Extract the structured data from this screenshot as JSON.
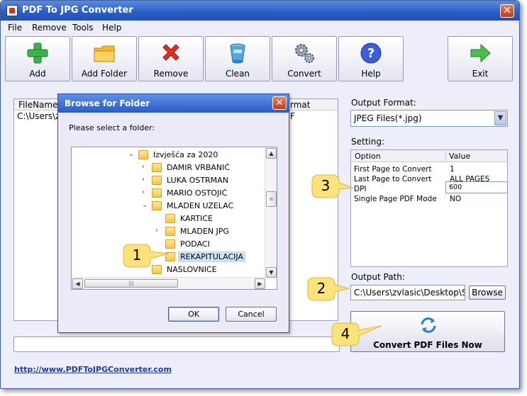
{
  "window": {
    "title": "PDF To JPG Converter",
    "close_glyph": "✕"
  },
  "menu": [
    "File",
    "Remove",
    "Tools",
    "Help"
  ],
  "toolbar": [
    {
      "label": "Add",
      "icon": "add-icon"
    },
    {
      "label": "Add Folder",
      "icon": "folder-icon"
    },
    {
      "label": "Remove",
      "icon": "remove-icon"
    },
    {
      "label": "Clean",
      "icon": "clean-icon"
    },
    {
      "label": "Convert",
      "icon": "convert-gears-icon"
    },
    {
      "label": "Help",
      "icon": "help-icon"
    },
    {
      "label": "Exit",
      "icon": "exit-arrow-icon"
    }
  ],
  "file_list": {
    "columns": [
      "FileName",
      "rmat"
    ],
    "rows": [
      {
        "filename": "C:\\Users\\zv",
        "format": "F"
      }
    ]
  },
  "output_format": {
    "label": "Output Format:",
    "value": "JPEG Files(*.jpg)"
  },
  "setting": {
    "label": "Setting:",
    "columns": [
      "Option",
      "Value"
    ],
    "rows": [
      {
        "option": "First Page to Convert",
        "value": "1"
      },
      {
        "option": "Last Page to Convert",
        "value": "ALL PAGES"
      },
      {
        "option": "DPI",
        "value": "600"
      },
      {
        "option": "Single Page PDF Mode",
        "value": "NO"
      }
    ]
  },
  "output_path": {
    "label": "Output Path:",
    "value": "C:\\Users\\zvlasic\\Desktop\\SAM",
    "browse_label": "Browse"
  },
  "convert_now_label": "Convert PDF Files Now",
  "footer_link": "http://www.PDFToJPGConverter.com",
  "dialog": {
    "title": "Browse for Folder",
    "close_glyph": "✕",
    "prompt": "Please select a folder:",
    "tree": [
      {
        "name": "Izvješća za 2020",
        "expander": "expanded",
        "level": 0
      },
      {
        "name": "DAMIR VRBANIĆ",
        "expander": "collapsed",
        "level": 1
      },
      {
        "name": "LUKA OSTRMAN",
        "expander": "collapsed",
        "level": 1
      },
      {
        "name": "MARIO OSTOJIĆ",
        "expander": "collapsed",
        "level": 1
      },
      {
        "name": "MLADEN UZELAC",
        "expander": "expanded",
        "level": 1
      },
      {
        "name": "KARTICE",
        "expander": "none",
        "level": 2
      },
      {
        "name": "MLADEN JPG",
        "expander": "collapsed",
        "level": 2
      },
      {
        "name": "PODACI",
        "expander": "none",
        "level": 2
      },
      {
        "name": "REKAPITULACIJA",
        "expander": "none",
        "level": 2,
        "selected": true
      },
      {
        "name": "NASLOVNICE",
        "expander": "none",
        "level": 1
      }
    ],
    "ok_label": "OK",
    "cancel_label": "Cancel"
  },
  "callouts": [
    "1",
    "2",
    "3",
    "4"
  ],
  "colors": {
    "titlebar": "#2a5cc4",
    "window_bg": "#eeeefb",
    "callout_fill": "#fbe27a",
    "link": "#1c3ca8"
  }
}
